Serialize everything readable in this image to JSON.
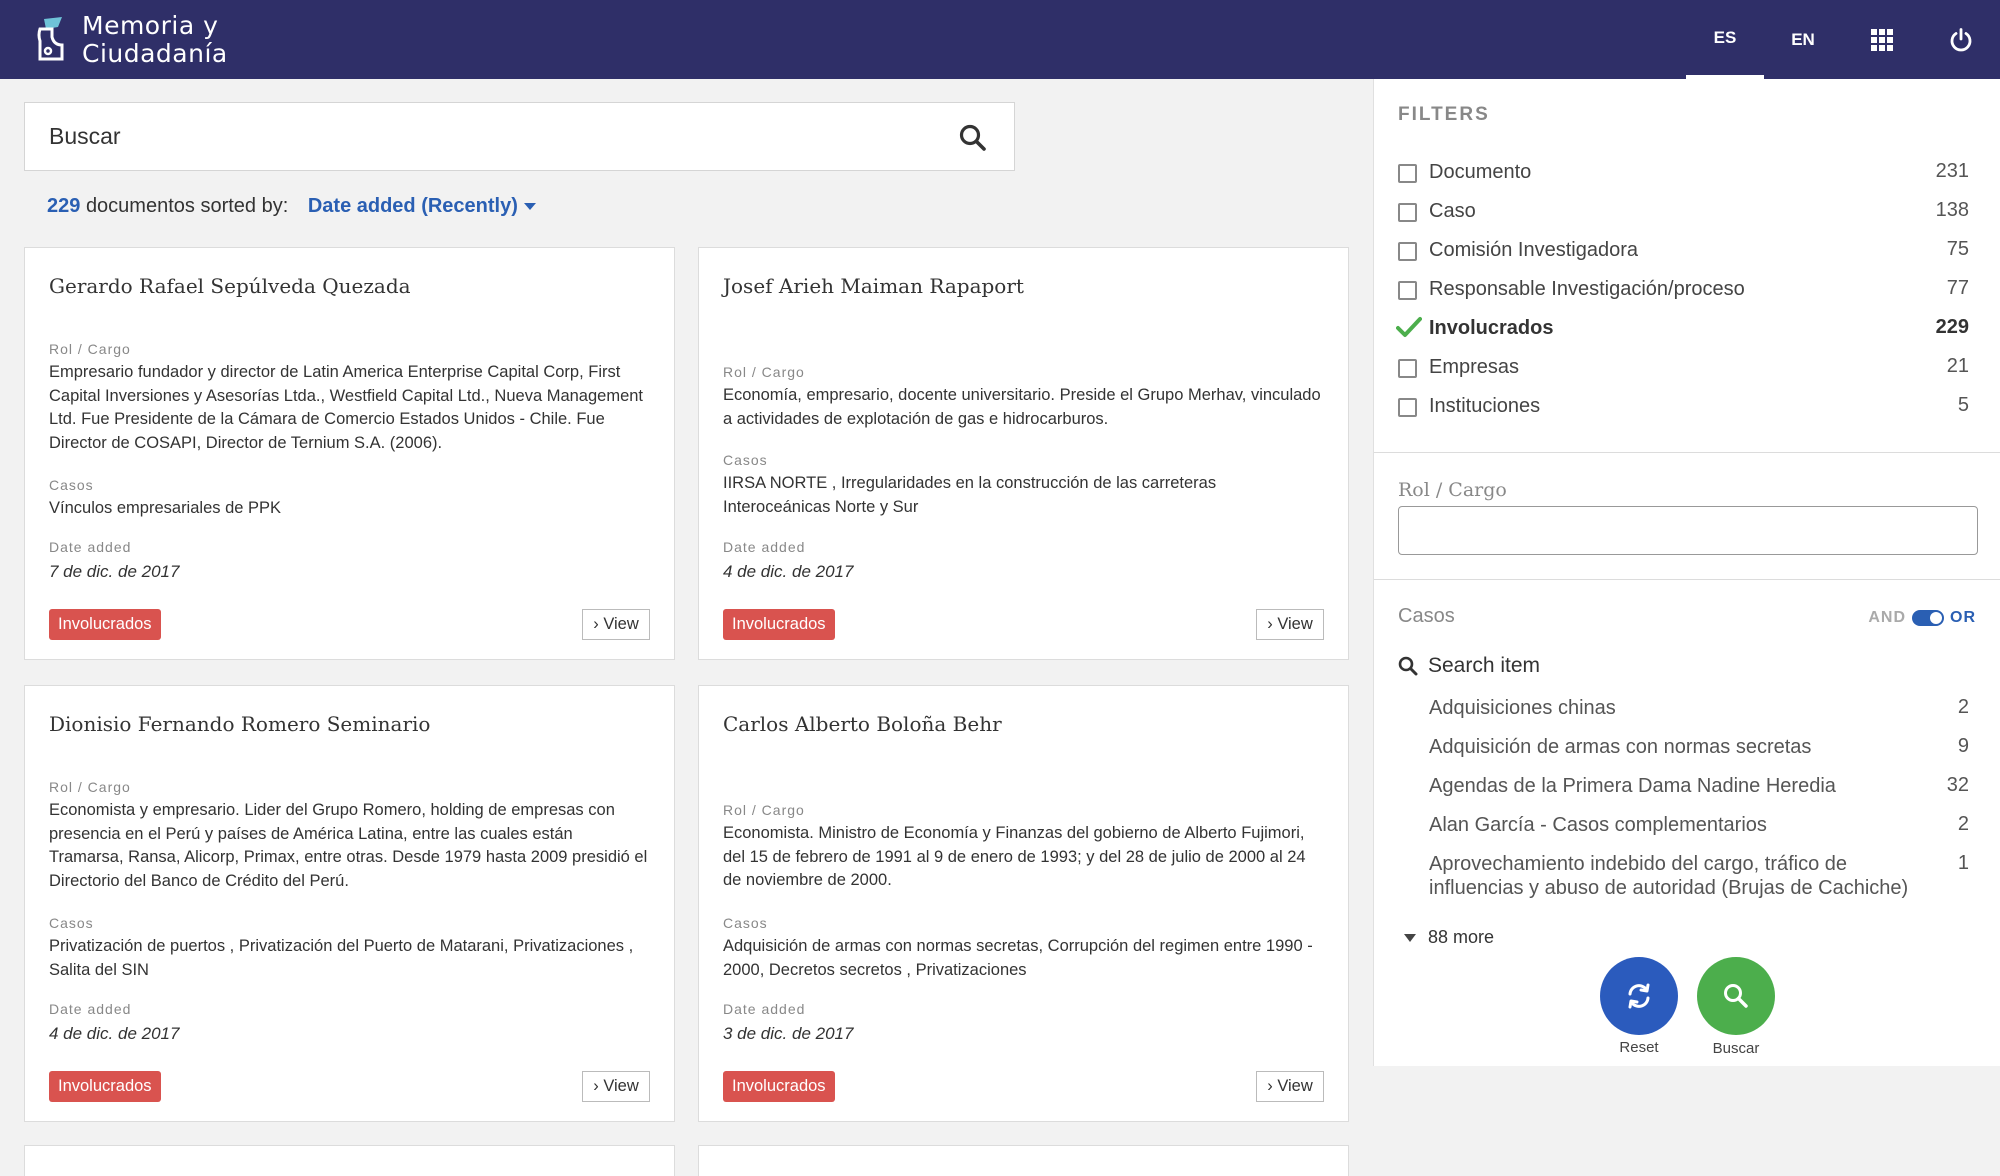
{
  "app": {
    "logo_line1": "Memoria y",
    "logo_line2": "Ciudadanía"
  },
  "nav": {
    "lang_es": "ES",
    "lang_en": "EN",
    "apps_icon": "grid-icon",
    "power_icon": "power-icon"
  },
  "search": {
    "placeholder": "Buscar"
  },
  "results": {
    "count": "229",
    "count_suffix": "documentos sorted by:",
    "sort_label": "Date added (Recently)"
  },
  "cards": [
    {
      "title": "Gerardo Rafael Sepúlveda Quezada",
      "rol_label": "Rol / Cargo",
      "rol": "Empresario fundador y director de Latin America Enterprise Capital Corp, First Capital Inversiones y Asesorías Ltda., Westfield Capital Ltd., Nueva Management Ltd. Fue Presidente de la Cámara de Comercio Estados Unidos - Chile. Fue Director de COSAPI, Director de Ternium S.A. (2006).",
      "casos_label": "Casos",
      "casos": "Vínculos empresariales de PPK",
      "date_label": "Date added",
      "date": "7 de dic. de 2017",
      "badge": "Involucrados",
      "view": "View"
    },
    {
      "title": "Josef Arieh Maiman Rapaport",
      "rol_label": "Rol / Cargo",
      "rol": "Economía, empresario, docente universitario. Preside el Grupo Merhav, vinculado a actividades de explotación de gas e hidrocarburos.",
      "casos_label": "Casos",
      "casos": "IIRSA NORTE , Irregularidades en la construcción de las carreteras Interoceánicas Norte y Sur",
      "date_label": "Date added",
      "date": "4 de dic. de 2017",
      "badge": "Involucrados",
      "view": "View"
    },
    {
      "title": "Dionisio Fernando Romero Seminario",
      "rol_label": "Rol / Cargo",
      "rol": "Economista y empresario. Lider del Grupo Romero, holding de empresas con presencia en el Perú y países de América Latina, entre las cuales están Tramarsa, Ransa, Alicorp, Primax, entre otras. Desde 1979 hasta 2009 presidió el Directorio del Banco de Crédito del Perú.",
      "casos_label": "Casos",
      "casos": "Privatización de puertos , Privatización del Puerto de Matarani, Privatizaciones , Salita del SIN",
      "date_label": "Date added",
      "date": "4 de dic. de 2017",
      "badge": "Involucrados",
      "view": "View"
    },
    {
      "title": "Carlos Alberto Boloña Behr",
      "rol_label": "Rol / Cargo",
      "rol": "Economista. Ministro de Economía y Finanzas del gobierno de Alberto Fujimori, del 15 de febrero de 1991 al 9 de enero de 1993; y del 28 de julio de 2000 al 24 de noviembre de 2000.",
      "casos_label": "Casos",
      "casos": "Adquisición de armas con normas secretas, Corrupción del regimen entre 1990 - 2000, Decretos secretos , Privatizaciones",
      "date_label": "Date added",
      "date": "3 de dic. de 2017",
      "badge": "Involucrados",
      "view": "View"
    }
  ],
  "filters": {
    "title": "FILTERS",
    "types": [
      {
        "label": "Documento",
        "count": "231",
        "checked": false
      },
      {
        "label": "Caso",
        "count": "138",
        "checked": false
      },
      {
        "label": "Comisión Investigadora",
        "count": "75",
        "checked": false
      },
      {
        "label": "Responsable Investigación/proceso",
        "count": "77",
        "checked": false
      },
      {
        "label": "Involucrados",
        "count": "229",
        "checked": true
      },
      {
        "label": "Empresas",
        "count": "21",
        "checked": false
      },
      {
        "label": "Instituciones",
        "count": "5",
        "checked": false
      }
    ],
    "rol_label": "Rol / Cargo",
    "casos_label": "Casos",
    "and_label": "AND",
    "or_label": "OR",
    "search_item": "Search item",
    "casos": [
      {
        "label": "Adquisiciones chinas",
        "count": "2"
      },
      {
        "label": "Adquisición de armas con normas secretas",
        "count": "9"
      },
      {
        "label": "Agendas de la Primera Dama Nadine Heredia",
        "count": "32"
      },
      {
        "label": "Alan García - Casos complementarios",
        "count": "2"
      },
      {
        "label": "Aprovechamiento indebido del cargo, tráfico de influencias y abuso de autoridad (Brujas de Cachiche)",
        "count": "1"
      }
    ],
    "more": "88 more",
    "reset": "Reset",
    "buscar": "Buscar"
  },
  "colors": {
    "header": "#2f2f68",
    "accent": "#2a5fb3",
    "badge": "#d9534f",
    "check": "#4cae4c"
  }
}
